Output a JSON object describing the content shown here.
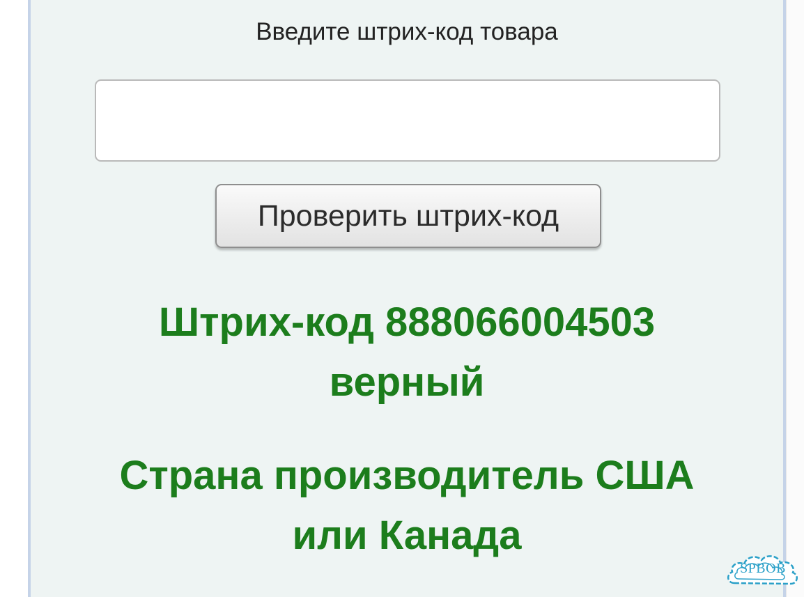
{
  "form": {
    "prompt": "Введите штрих-код товара",
    "input_value": "",
    "input_placeholder": "",
    "check_button_label": "Проверить штрих-код"
  },
  "result": {
    "line1": "Штрих-код 888066004503",
    "line2": "верный",
    "line3": "Страна производитель США",
    "line4": "или Канада",
    "color": "#1c7d1c"
  },
  "watermark": {
    "text": "SPBOB"
  }
}
